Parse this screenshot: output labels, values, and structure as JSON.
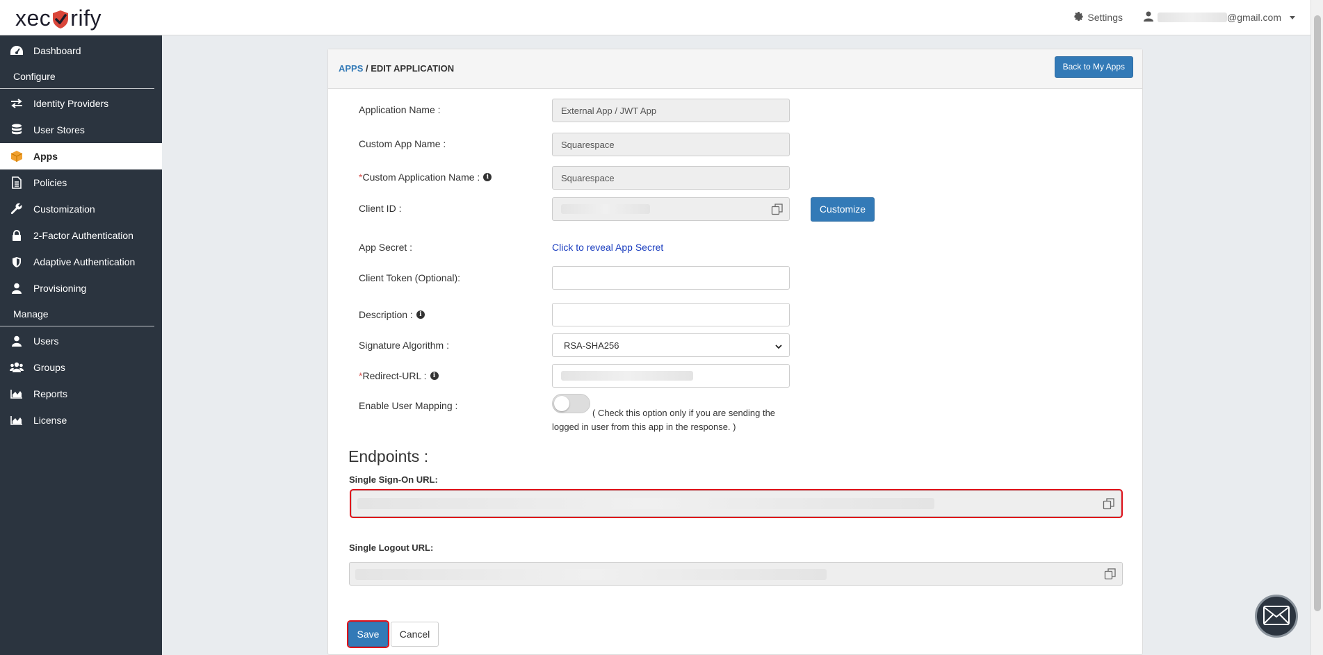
{
  "header": {
    "logo_text_left": "xec",
    "logo_text_right": "rify",
    "settings_label": "Settings",
    "user_email_suffix": "@gmail.com"
  },
  "sidebar": {
    "items": [
      {
        "label": "Dashboard",
        "icon": "dashboard-icon"
      },
      {
        "section": "Configure"
      },
      {
        "label": "Identity Providers",
        "icon": "exchange-icon"
      },
      {
        "label": "User Stores",
        "icon": "database-icon"
      },
      {
        "label": "Apps",
        "icon": "cube-icon",
        "active": true
      },
      {
        "label": "Policies",
        "icon": "document-icon"
      },
      {
        "label": "Customization",
        "icon": "wrench-icon"
      },
      {
        "label": "2-Factor Authentication",
        "icon": "lock-icon"
      },
      {
        "label": "Adaptive Authentication",
        "icon": "shield-icon"
      },
      {
        "label": "Provisioning",
        "icon": "user-icon"
      },
      {
        "section": "Manage"
      },
      {
        "label": "Users",
        "icon": "user-icon"
      },
      {
        "label": "Groups",
        "icon": "users-icon"
      },
      {
        "label": "Reports",
        "icon": "area-chart-icon"
      },
      {
        "label": "License",
        "icon": "area-chart-icon"
      }
    ]
  },
  "panel": {
    "breadcrumb_link": "APPS",
    "breadcrumb_sep": " / ",
    "breadcrumb_current": "EDIT APPLICATION",
    "back_button": "Back to My Apps"
  },
  "form": {
    "application_name_label": "Application Name :",
    "application_name_value": "External App / JWT App",
    "custom_app_name_label": "Custom App Name :",
    "custom_app_name_value": "Squarespace",
    "custom_application_name_label": "Custom Application Name :",
    "custom_application_name_value": "Squarespace",
    "client_id_label": "Client ID :",
    "customize_button": "Customize",
    "app_secret_label": "App Secret :",
    "reveal_link": "Click to reveal App Secret",
    "client_token_label": "Client Token (Optional):",
    "description_label": "Description :",
    "signature_algorithm_label": "Signature Algorithm :",
    "signature_algorithm_value": "RSA-SHA256",
    "redirect_url_label": "Redirect-URL :",
    "enable_user_mapping_label": "Enable User Mapping :",
    "user_mapping_enabled": false,
    "user_mapping_help": "( Check this option only if you are sending the logged in user from this app in the response. )"
  },
  "endpoints": {
    "title": "Endpoints :",
    "sso_label": "Single Sign-On URL:",
    "slo_label": "Single Logout URL:"
  },
  "actions": {
    "save_button": "Save",
    "cancel_button": "Cancel"
  },
  "colors": {
    "primary": "#337ab7",
    "sidebar_bg": "#2b343f",
    "highlight": "#e0121b"
  }
}
